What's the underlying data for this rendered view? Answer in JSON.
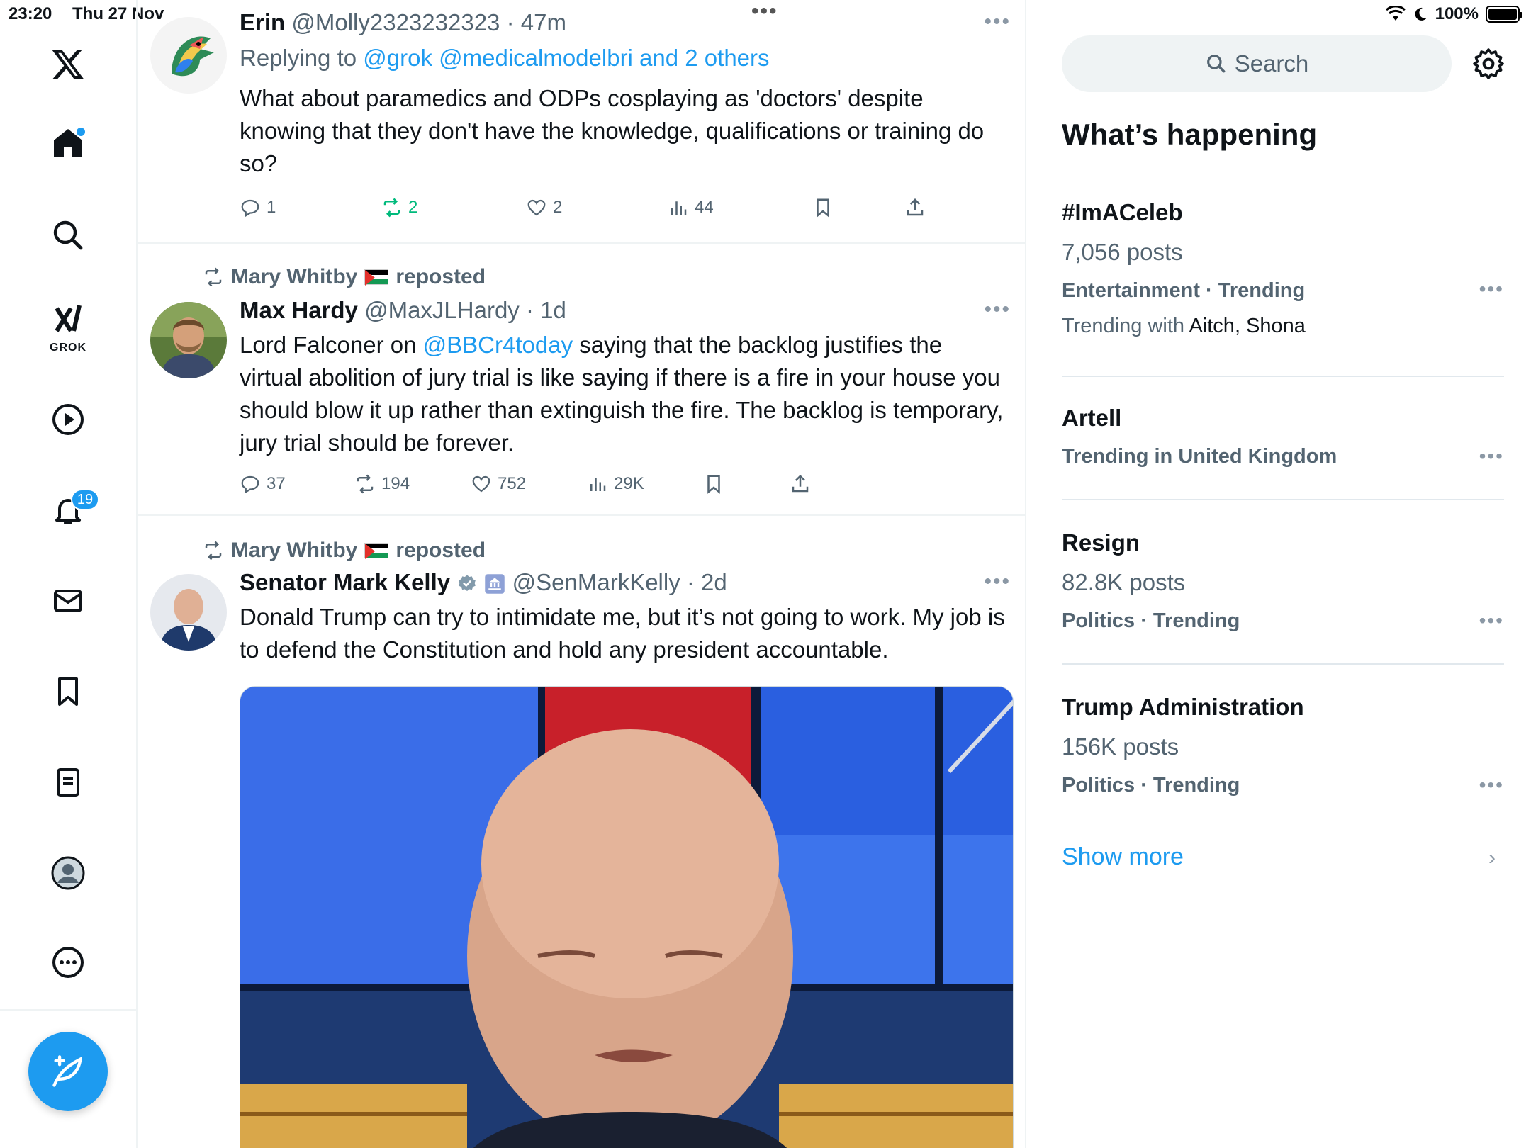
{
  "status_bar": {
    "time": "23:20",
    "date": "Thu 27 Nov",
    "battery": "100%"
  },
  "nav": {
    "grok_label": "GROK",
    "notifications_count": "19"
  },
  "tweets": [
    {
      "name": "Erin",
      "handle": "@Molly2323232323",
      "time": "· 47m",
      "replying_prefix": "Replying to ",
      "replying_to": "@grok @medicalmodelbri and 2 others",
      "text": "What about paramedics and ODPs cosplaying as 'doctors' despite knowing that they don't have the knowledge, qualifications or training do so?",
      "replies": "1",
      "reposts": "2",
      "likes": "2",
      "views": "44"
    },
    {
      "reposted_by": "Mary Whitby",
      "reposted_suffix": "reposted",
      "name": "Max Hardy",
      "handle": "@MaxJLHardy",
      "time": "· 1d",
      "text_before": "Lord Falconer on ",
      "mention": "@BBCr4today",
      "text_after": " saying that the backlog justifies the virtual abolition of jury trial is like saying if there is a fire in your house you should blow it up rather than extinguish the fire. The backlog is temporary, jury trial should be forever.",
      "replies": "37",
      "reposts": "194",
      "likes": "752",
      "views": "29K"
    },
    {
      "reposted_by": "Mary Whitby",
      "reposted_suffix": "reposted",
      "name": "Senator Mark Kelly",
      "handle": "@SenMarkKelly",
      "time": "· 2d",
      "text": "Donald Trump can try to intimidate me, but it’s not going to work. My job is to defend the Constitution and hold any president accountable."
    }
  ],
  "right": {
    "search_placeholder": "Search",
    "section_title": "What’s happening",
    "trends": [
      {
        "name": "#ImACeleb",
        "posts": "7,056 posts",
        "category": "Entertainment · Trending",
        "with_prefix": "Trending with ",
        "with_names": "Aitch, Shona"
      },
      {
        "name": "Artell",
        "category": "Trending in United Kingdom"
      },
      {
        "name": "Resign",
        "posts": "82.8K posts",
        "category": "Politics · Trending"
      },
      {
        "name": "Trump Administration",
        "posts": "156K posts",
        "category": "Politics · Trending"
      }
    ],
    "show_more": "Show more"
  },
  "colors": {
    "accent": "#1d9bf0",
    "repost_green": "#00ba7c",
    "secondary_text": "#536471"
  }
}
